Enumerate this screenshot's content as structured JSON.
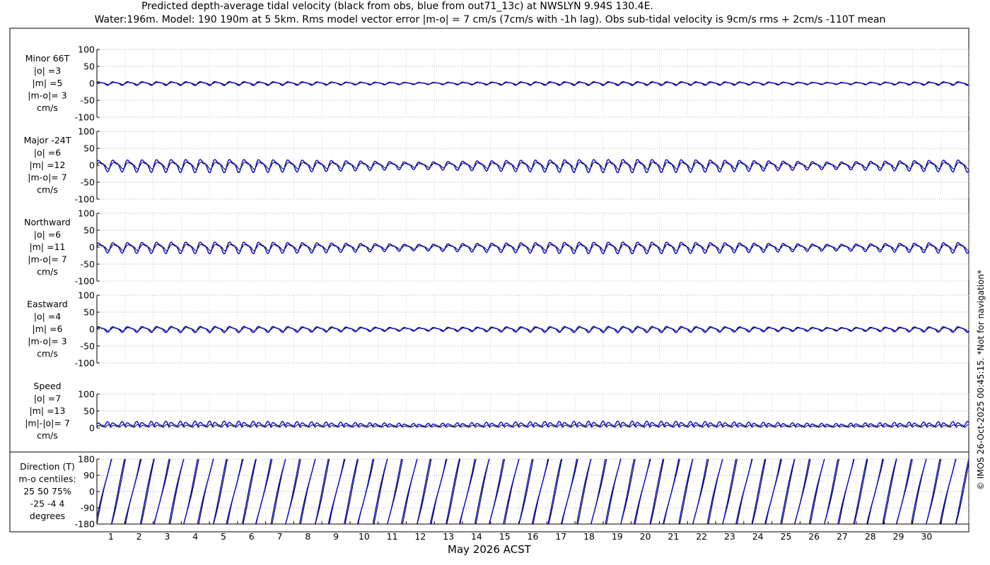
{
  "title_line1": "Predicted depth-average tidal velocity (black from obs, blue from out71_13c) at NWSLYN 9.94S 130.4E.",
  "title_line2": "Water:196m. Model: 190 190m at 5 5km. Rms model vector error |m-o| = 7 cm/s (7cm/s with -1h lag). Obs sub-tidal velocity is 9cm/s rms + 2cm/s -110T mean",
  "xlabel": "May 2026 ACST",
  "side_note": "© IMOS 26-Oct-2025 00:45:15. *Not for navigation*",
  "colors": {
    "obs": "#000000",
    "model": "#1010d0"
  },
  "chart_data": [
    {
      "type": "line",
      "panel": "Minor 66T",
      "label_lines": [
        "Minor 66T",
        "|o| =3",
        "|m| =5",
        "|m-o|= 3",
        "cm/s"
      ],
      "ylim": [
        -100,
        100
      ],
      "yticks": [
        "100",
        "50",
        "0",
        "-50",
        "-100"
      ],
      "grid": true,
      "x_range_days": [
        0,
        31
      ],
      "series": [
        {
          "name": "obs",
          "amplitude_cms": 3
        },
        {
          "name": "model",
          "amplitude_cms": 5
        }
      ]
    },
    {
      "type": "line",
      "panel": "Major -24T",
      "label_lines": [
        "Major -24T",
        "|o| =6",
        "|m| =12",
        "|m-o|= 7",
        "cm/s"
      ],
      "ylim": [
        -100,
        100
      ],
      "yticks": [
        "100",
        "50",
        "0",
        "-50",
        "-100"
      ],
      "grid": true,
      "x_range_days": [
        0,
        31
      ],
      "series": [
        {
          "name": "obs",
          "amplitude_cms": 9
        },
        {
          "name": "model",
          "amplitude_cms": 17
        }
      ]
    },
    {
      "type": "line",
      "panel": "Northward",
      "label_lines": [
        "Northward",
        "|o| =6",
        "|m| =11",
        "|m-o|= 7",
        "cm/s"
      ],
      "ylim": [
        -100,
        100
      ],
      "yticks": [
        "100",
        "50",
        "0",
        "-50",
        "-100"
      ],
      "grid": true,
      "x_range_days": [
        0,
        31
      ],
      "series": [
        {
          "name": "obs",
          "amplitude_cms": 8
        },
        {
          "name": "model",
          "amplitude_cms": 15
        }
      ]
    },
    {
      "type": "line",
      "panel": "Eastward",
      "label_lines": [
        "Eastward",
        "|o| =4",
        "|m| =6",
        "|m-o|= 3",
        "cm/s"
      ],
      "ylim": [
        -100,
        100
      ],
      "yticks": [
        "100",
        "50",
        "0",
        "-50",
        "-100"
      ],
      "grid": true,
      "x_range_days": [
        0,
        31
      ],
      "series": [
        {
          "name": "obs",
          "amplitude_cms": 5
        },
        {
          "name": "model",
          "amplitude_cms": 8
        }
      ]
    },
    {
      "type": "line",
      "panel": "Speed",
      "label_lines": [
        "Speed",
        "|o| =7",
        "|m| =13",
        "|m|-|o|= 7",
        "cm/s"
      ],
      "ylim": [
        0,
        100
      ],
      "yticks": [
        "100",
        "50",
        "0"
      ],
      "grid": true,
      "x_range_days": [
        0,
        31
      ],
      "series": [
        {
          "name": "obs",
          "amplitude_cms": 7
        },
        {
          "name": "model",
          "amplitude_cms": 14
        }
      ]
    },
    {
      "type": "line",
      "panel": "Direction (T)",
      "label_lines": [
        "Direction (T)",
        "m-o centiles:",
        "25  50  75%",
        "-25  -4   4",
        "degrees"
      ],
      "ylim": [
        -180,
        180
      ],
      "yticks": [
        "180",
        "90",
        "0",
        "-90",
        "-180"
      ],
      "grid": true,
      "x_range_days": [
        0,
        31
      ],
      "series": [
        {
          "name": "obs"
        },
        {
          "name": "model"
        }
      ]
    }
  ],
  "x_ticks": [
    "1",
    "2",
    "3",
    "4",
    "5",
    "6",
    "7",
    "8",
    "9",
    "10",
    "11",
    "12",
    "13",
    "14",
    "15",
    "16",
    "17",
    "18",
    "19",
    "20",
    "21",
    "22",
    "23",
    "24",
    "25",
    "26",
    "27",
    "28",
    "29",
    "30"
  ]
}
